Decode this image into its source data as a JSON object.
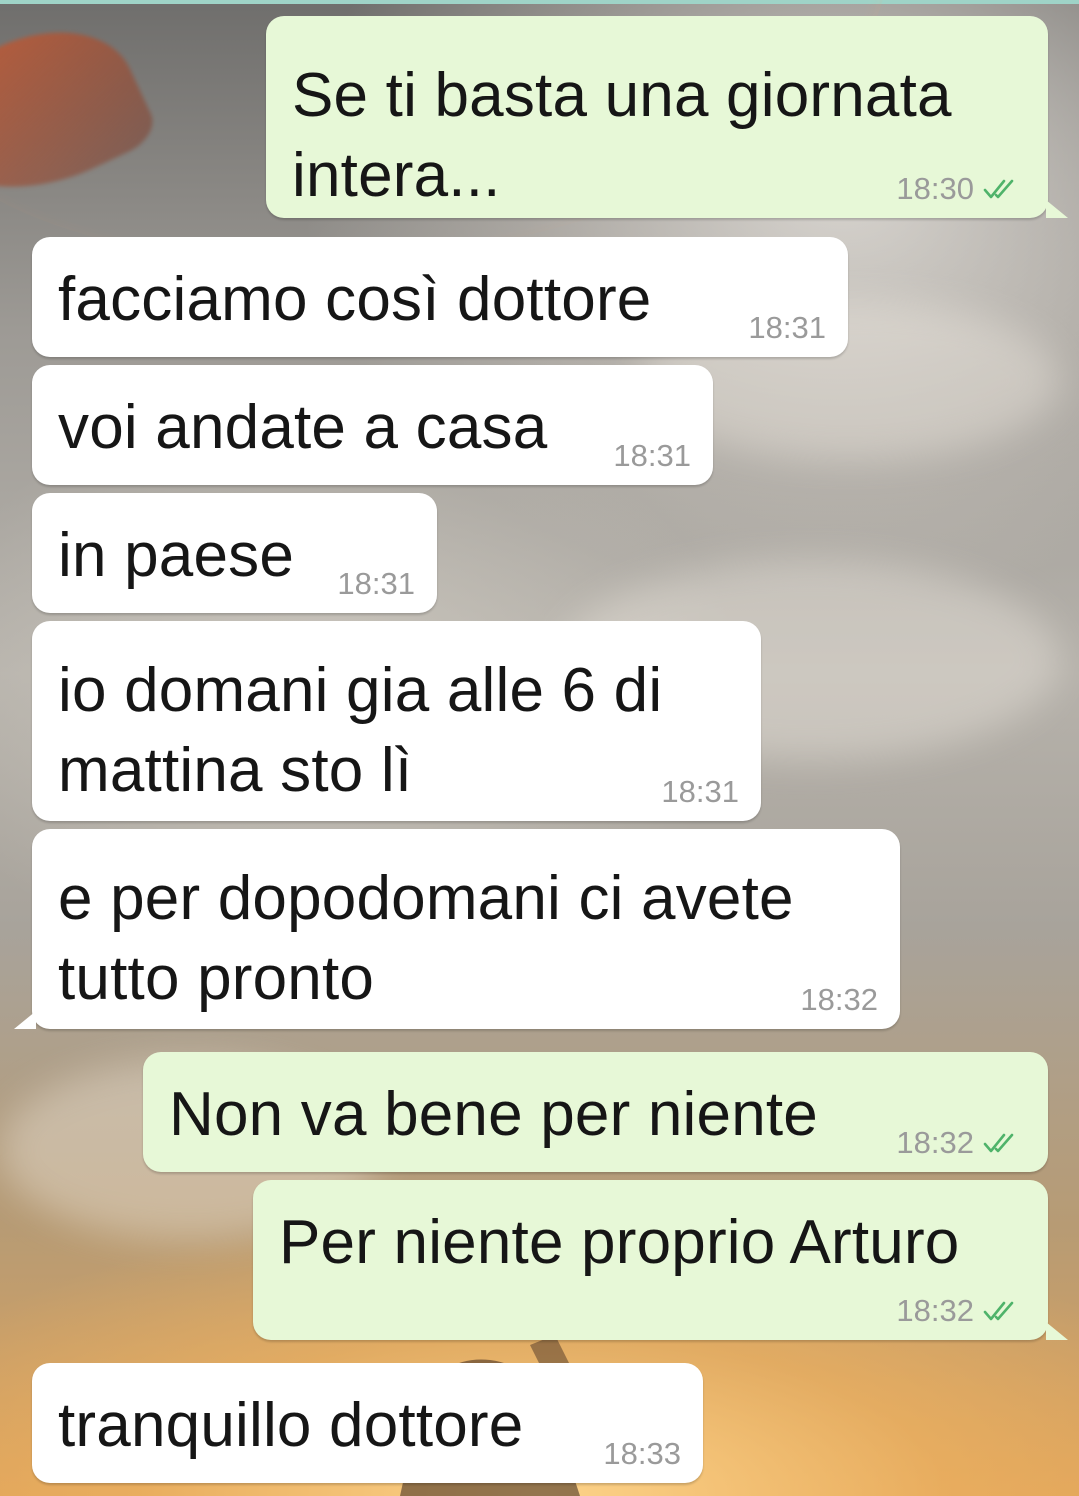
{
  "chat": {
    "messages": [
      {
        "direction": "outgoing",
        "text": "Se ti basta una giornata\nintera...",
        "time": "18:30",
        "status_icon": "double-check-read-icon"
      },
      {
        "direction": "incoming",
        "text": "facciamo così dottore",
        "time": "18:31"
      },
      {
        "direction": "incoming",
        "text": "voi andate a casa",
        "time": "18:31"
      },
      {
        "direction": "incoming",
        "text": "in paese",
        "time": "18:31"
      },
      {
        "direction": "incoming",
        "text": "io domani gia alle 6 di\nmattina sto lì",
        "time": "18:31"
      },
      {
        "direction": "incoming",
        "text": "e per dopodomani ci avete\ntutto pronto",
        "time": "18:32"
      },
      {
        "direction": "outgoing",
        "text": "Non va bene per niente",
        "time": "18:32",
        "status_icon": "double-check-read-icon"
      },
      {
        "direction": "outgoing",
        "text": "Per niente proprio Arturo",
        "time": "18:32",
        "status_icon": "double-check-read-icon"
      },
      {
        "direction": "incoming",
        "text": "tranquillo dottore",
        "time": "18:33"
      }
    ]
  },
  "colors": {
    "incoming_bubble": "#ffffff",
    "outgoing_bubble": "#e7f8d7",
    "timestamp": "#9a9a9a",
    "read_ticks": "#4fb36a"
  }
}
